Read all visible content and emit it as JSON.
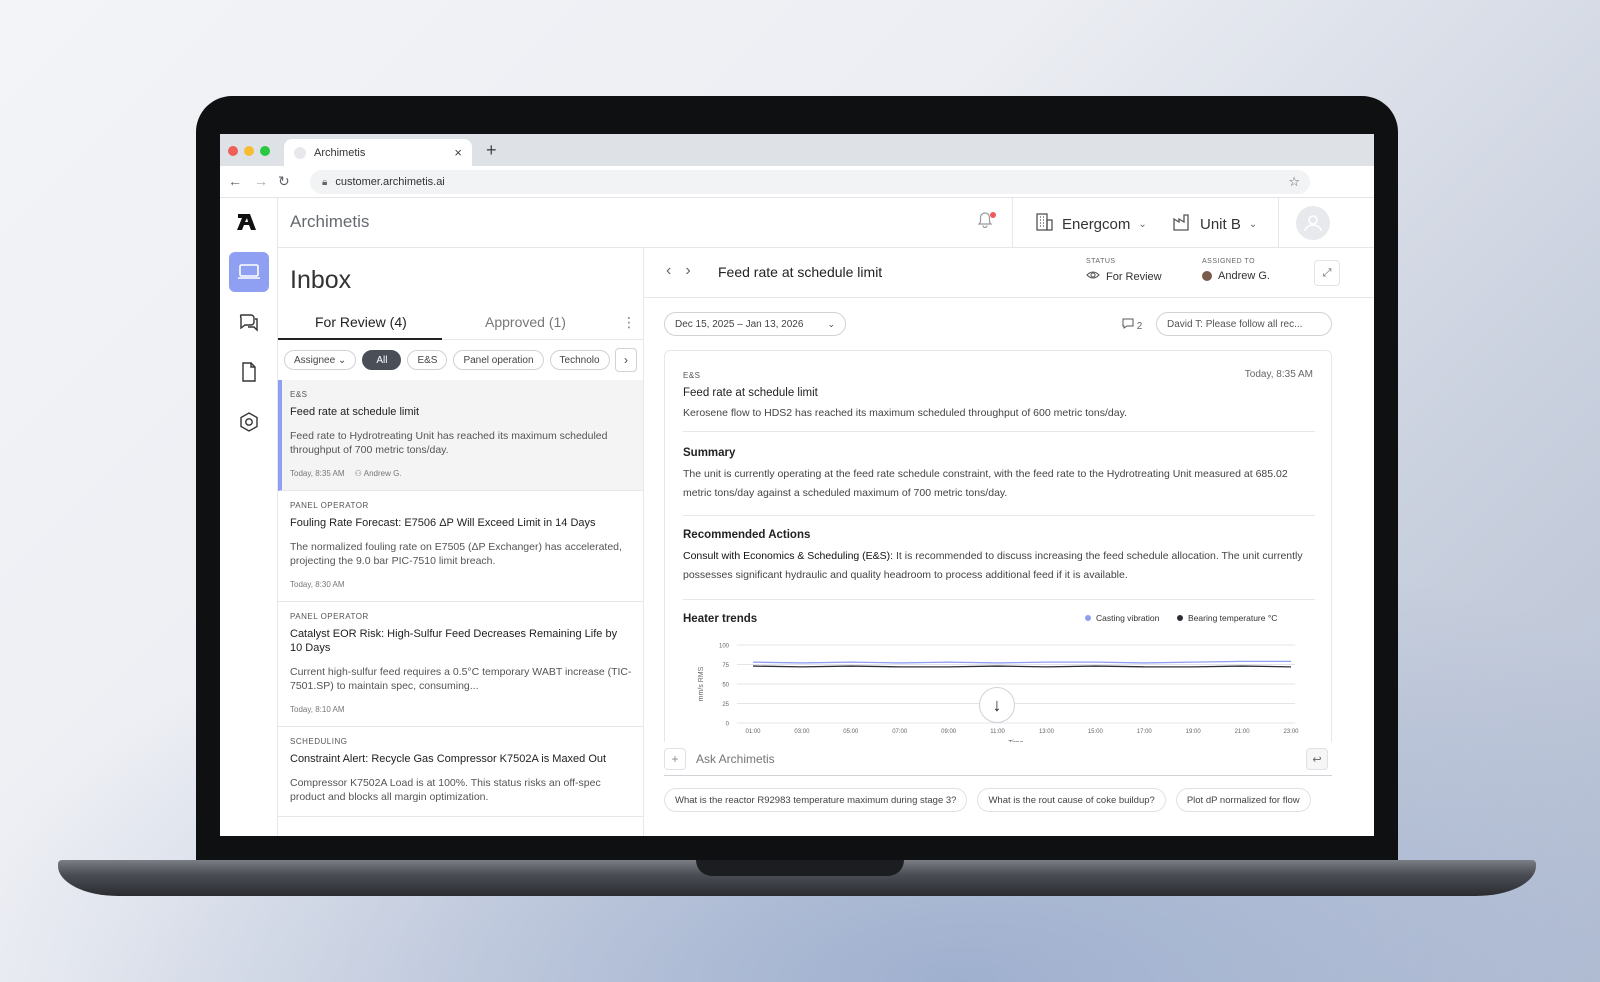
{
  "browser": {
    "tab_title": "Archimetis",
    "url": "customer.archimetis.ai"
  },
  "app": {
    "brand": "Archimetis",
    "company": "Energcom",
    "unit": "Unit B"
  },
  "inbox": {
    "title": "Inbox",
    "tabs": [
      {
        "label": "For Review (4)"
      },
      {
        "label": "Approved (1)"
      }
    ],
    "filters": {
      "assignee": "Assignee",
      "chips": [
        "All",
        "E&S",
        "Panel operation",
        "Technolo"
      ]
    },
    "items": [
      {
        "category": "E&S",
        "title": "Feed rate at schedule limit",
        "body": "Feed rate to Hydrotreating Unit has reached its maximum scheduled throughput of 700 metric tons/day.",
        "time": "Today, 8:35 AM",
        "assignee": "Andrew G."
      },
      {
        "category": "Panel operator",
        "title": "Fouling Rate Forecast: E7506 ΔP Will Exceed Limit in 14 Days",
        "body": "The normalized fouling rate on E7505 (ΔP Exchanger) has accelerated, projecting the 9.0 bar PIC-7510 limit breach.",
        "time": "Today, 8:30 AM"
      },
      {
        "category": "Panel operator",
        "title": "Catalyst EOR Risk: High-Sulfur Feed Decreases Remaining Life by 10 Days",
        "body": "Current high-sulfur feed requires a 0.5°C temporary WABT increase (TIC-7501.SP) to maintain spec, consuming...",
        "time": "Today, 8:10 AM"
      },
      {
        "category": "Scheduling",
        "title": "Constraint Alert: Recycle Gas Compressor K7502A is Maxed Out",
        "body": "Compressor K7502A Load is at 100%. This status risks an off-spec product and blocks all margin optimization."
      }
    ]
  },
  "detail": {
    "title": "Feed rate at schedule limit",
    "status_label": "STATUS",
    "status": "For Review",
    "assigned_label": "ASSIGNED TO",
    "assigned": "Andrew G.",
    "date_range": "Dec 15, 2025 – Jan 13, 2026",
    "comment_count": "2",
    "comment_preview": "David T: Please follow all rec...",
    "card": {
      "category": "E&S",
      "time": "Today, 8:35 AM",
      "title": "Feed rate at schedule limit",
      "body": "Kerosene flow to HDS2 has reached its maximum scheduled throughput of 600 metric tons/day.",
      "summary_title": "Summary",
      "summary": "The unit is currently operating at the feed rate schedule constraint, with the feed rate to the Hydrotreating Unit measured at 685.02 metric tons/day against a scheduled maximum of 700 metric tons/day.",
      "actions_title": "Recommended Actions",
      "actions_lead": "Consult with Economics & Scheduling (E&S):",
      "actions": " It is recommended to discuss increasing the feed schedule allocation. The unit currently possesses significant hydraulic and quality headroom to process additional feed if it is available."
    },
    "ask_placeholder": "Ask Archimetis",
    "suggestions": [
      "What is the reactor R92983 temperature  maximum during stage 3?",
      "What is the rout cause of coke buildup?",
      "Plot dP normalized for flow"
    ]
  },
  "colors": {
    "accent": "#8f9ff2",
    "series1": "#8f9ff2",
    "series2": "#2b2e33"
  },
  "chart_data": {
    "type": "line",
    "title": "Heater trends",
    "xlabel": "Time",
    "ylabel": "mm/s RMS",
    "ylim": [
      0,
      100
    ],
    "yticks": [
      0,
      25,
      50,
      75,
      100
    ],
    "x": [
      "01:00",
      "03:00",
      "05:00",
      "07:00",
      "09:00",
      "11:00",
      "13:00",
      "15:00",
      "17:00",
      "19:00",
      "21:00",
      "23:00"
    ],
    "series": [
      {
        "name": "Casting vibration",
        "color": "#8f9ff2",
        "values": [
          78,
          77,
          78,
          77,
          78,
          77,
          78,
          78,
          77,
          78,
          79,
          79
        ]
      },
      {
        "name": "Bearing temperature °C",
        "color": "#2b2e33",
        "values": [
          73,
          72,
          73,
          72,
          72,
          73,
          72,
          73,
          72,
          72,
          73,
          72
        ]
      }
    ],
    "legend": "top-right",
    "grid": true
  }
}
